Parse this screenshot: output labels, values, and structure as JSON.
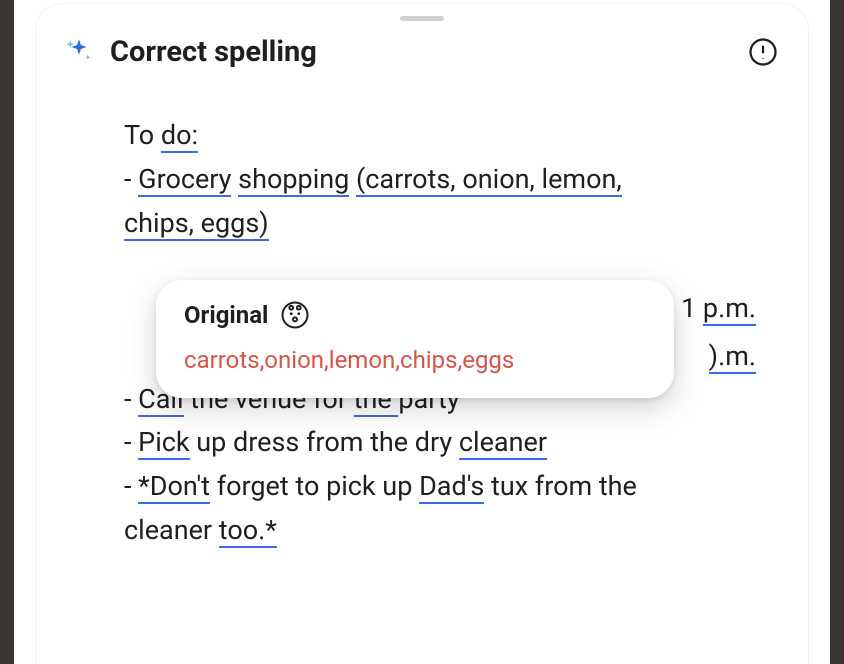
{
  "header": {
    "title": "Correct spelling"
  },
  "content": {
    "line0_pre": "To ",
    "line0_u": "do:",
    "line1_dash": "- ",
    "line1_u1": "Grocery",
    "line1_sp": " ",
    "line1_u2": "shopping",
    "line1_mid": " ",
    "line1_u3": "(carrots, onion, lemon,",
    "line2_u": "chips, eggs)",
    "frag_pm_pre": "1 ",
    "frag_pm_u": "p.m.",
    "frag_om_u": ").m.",
    "line5_dash": "- ",
    "line5_u1": "Call",
    "line5_mid": " the venue for ",
    "line5_u2": "the ",
    "line5_end": "party",
    "line6_dash": "- ",
    "line6_u1": "Pick",
    "line6_mid": " up dress from the dry ",
    "line6_u2": "cleaner",
    "line7_dash": "- ",
    "line7_u1": "*Don't",
    "line7_mid": " forget to pick up ",
    "line7_u2": "Dad's",
    "line7_end": " tux from the",
    "line8_pre": "cleaner ",
    "line8_u": "too.*"
  },
  "popover": {
    "label": "Original",
    "text": "carrots,onion,lemon,chips,eggs"
  }
}
